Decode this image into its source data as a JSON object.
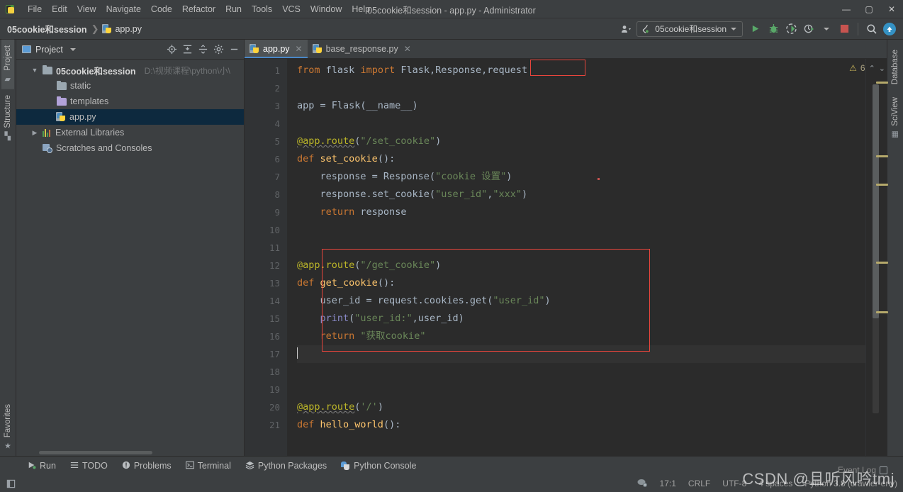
{
  "window": {
    "title": "05cookie和session - app.py - Administrator",
    "minimize": "—",
    "maximize": "▢",
    "close": "✕"
  },
  "menubar": {
    "items": [
      {
        "label": "File"
      },
      {
        "label": "Edit"
      },
      {
        "label": "View"
      },
      {
        "label": "Navigate"
      },
      {
        "label": "Code"
      },
      {
        "label": "Refactor"
      },
      {
        "label": "Run"
      },
      {
        "label": "Tools"
      },
      {
        "label": "VCS"
      },
      {
        "label": "Window"
      },
      {
        "label": "Help"
      }
    ]
  },
  "navbar": {
    "project_name": "05cookie和session",
    "separator": "❯",
    "file_name": "app.py",
    "run_config": "05cookie和session",
    "icons": {
      "user_settings": "share-icon",
      "run": "run-icon",
      "debug": "debug-icon",
      "run_with_coverage": "coverage-icon",
      "profile": "profile-icon",
      "stop": "stop-icon",
      "search": "search-icon",
      "update": "update-icon"
    }
  },
  "left_strip": {
    "project_tab": "Project",
    "structure_tab": "Structure",
    "favorites_tab": "Favorites"
  },
  "right_strip": {
    "database_tab": "Database",
    "sciview_tab": "SciView"
  },
  "project_panel": {
    "title": "Project",
    "toolbar_icons": [
      "locate-icon",
      "expand-all-icon",
      "collapse-all-icon",
      "settings-gear-icon",
      "hide-icon"
    ],
    "tree": [
      {
        "label": "05cookie和session",
        "hint": "D:\\视频课程\\python\\小\\",
        "depth": 0,
        "arrow": "v",
        "icon": "folder-icon",
        "bold": true,
        "selected": false
      },
      {
        "label": "static",
        "hint": "",
        "depth": 1,
        "arrow": "",
        "icon": "folder-icon",
        "bold": false,
        "selected": false
      },
      {
        "label": "templates",
        "hint": "",
        "depth": 1,
        "arrow": "",
        "icon": "folder-purple-icon",
        "bold": false,
        "selected": false
      },
      {
        "label": "app.py",
        "hint": "",
        "depth": 1,
        "arrow": "",
        "icon": "python-file-icon",
        "bold": false,
        "selected": true
      },
      {
        "label": "External Libraries",
        "hint": "",
        "depth": 0,
        "arrow": ">",
        "icon": "library-icon",
        "bold": false,
        "selected": false
      },
      {
        "label": "Scratches and Consoles",
        "hint": "",
        "depth": 0,
        "arrow": "",
        "icon": "scratches-icon",
        "bold": false,
        "selected": false
      }
    ]
  },
  "editor": {
    "tabs": [
      {
        "label": "app.py",
        "active": true,
        "close": "✕"
      },
      {
        "label": "base_response.py",
        "active": false,
        "close": "✕"
      }
    ],
    "warning_count": "6",
    "warning_icon": "warning-triangle-icon",
    "nav_up": "⌃",
    "nav_down": "⌄",
    "lines": [
      {
        "n": "1",
        "text": "from flask import Flask,Response,request"
      },
      {
        "n": "2",
        "text": ""
      },
      {
        "n": "3",
        "text": "app = Flask(__name__)"
      },
      {
        "n": "4",
        "text": ""
      },
      {
        "n": "5",
        "text": "@app.route(\"/set_cookie\")"
      },
      {
        "n": "6",
        "text": "def set_cookie():"
      },
      {
        "n": "7",
        "text": "    response = Response(\"cookie 设置\")"
      },
      {
        "n": "8",
        "text": "    response.set_cookie(\"user_id\",\"xxx\")"
      },
      {
        "n": "9",
        "text": "    return response"
      },
      {
        "n": "10",
        "text": ""
      },
      {
        "n": "11",
        "text": ""
      },
      {
        "n": "12",
        "text": "@app.route(\"/get_cookie\")"
      },
      {
        "n": "13",
        "text": "def get_cookie():"
      },
      {
        "n": "14",
        "text": "    user_id = request.cookies.get(\"user_id\")"
      },
      {
        "n": "15",
        "text": "    print(\"user_id:\",user_id)"
      },
      {
        "n": "16",
        "text": "    return \"获取cookie\""
      },
      {
        "n": "17",
        "text": ""
      },
      {
        "n": "18",
        "text": ""
      },
      {
        "n": "19",
        "text": ""
      },
      {
        "n": "20",
        "text": "@app.route('/')"
      },
      {
        "n": "21",
        "text": "def hello_world():"
      }
    ]
  },
  "annotations": {
    "request_box": "request",
    "block_box": "get_cookie-route-block"
  },
  "bottom_tools": [
    {
      "label": "Run",
      "icon": "run-triangle-icon"
    },
    {
      "label": "TODO",
      "icon": "todo-list-icon"
    },
    {
      "label": "Problems",
      "icon": "problems-icon"
    },
    {
      "label": "Terminal",
      "icon": "terminal-icon"
    },
    {
      "label": "Python Packages",
      "icon": "packages-icon"
    },
    {
      "label": "Python Console",
      "icon": "python-console-icon"
    }
  ],
  "statusbar": {
    "caret_position": "17:1",
    "line_separator": "CRLF",
    "encoding": "UTF-8",
    "indent": "4 spaces",
    "interpreter": "Python 3.8 (crawler-env)",
    "event_log": "Event Log",
    "inspection_icon": "inspection-icon"
  },
  "watermark": "CSDN @且听风吟tmj",
  "colors": {
    "accent_blue": "#4a88c7",
    "annotation_red": "#e8453c",
    "keyword_orange": "#cc7832",
    "string_green": "#6a8759",
    "decorator_yellow": "#bbb529",
    "function_yellow": "#ffc66d",
    "editor_bg": "#2b2b2b",
    "chrome_bg": "#3c3f41",
    "selection_blue": "#0d293e"
  }
}
